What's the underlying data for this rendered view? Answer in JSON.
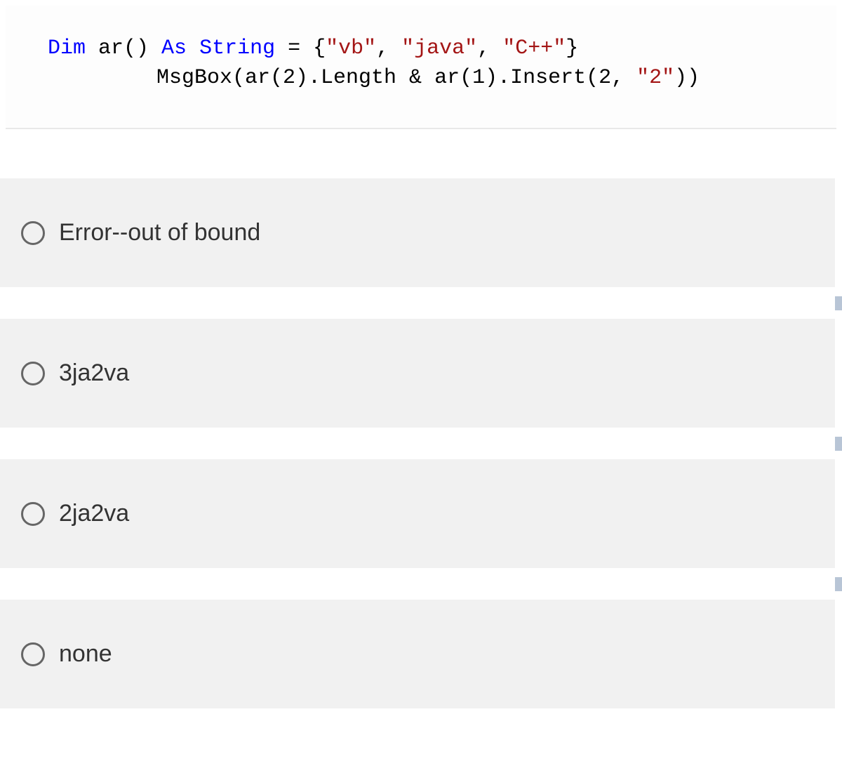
{
  "code": {
    "line1": {
      "prefix": "Dim",
      "rest": " ar() ",
      "as": "As",
      "type": " String",
      "assign": " = {",
      "s1": "\"vb\"",
      "c1": ", ",
      "s2": "\"java\"",
      "c2": ", ",
      "s3": "\"C++\"",
      "end": "}"
    },
    "line2": {
      "pre": "MsgBox(ar(2).Length & ar(1).Insert(2, ",
      "s": "\"2\"",
      "post": "))"
    }
  },
  "options": [
    {
      "label": "Error--out of bound"
    },
    {
      "label": "3ja2va"
    },
    {
      "label": "2ja2va"
    },
    {
      "label": "none"
    }
  ]
}
